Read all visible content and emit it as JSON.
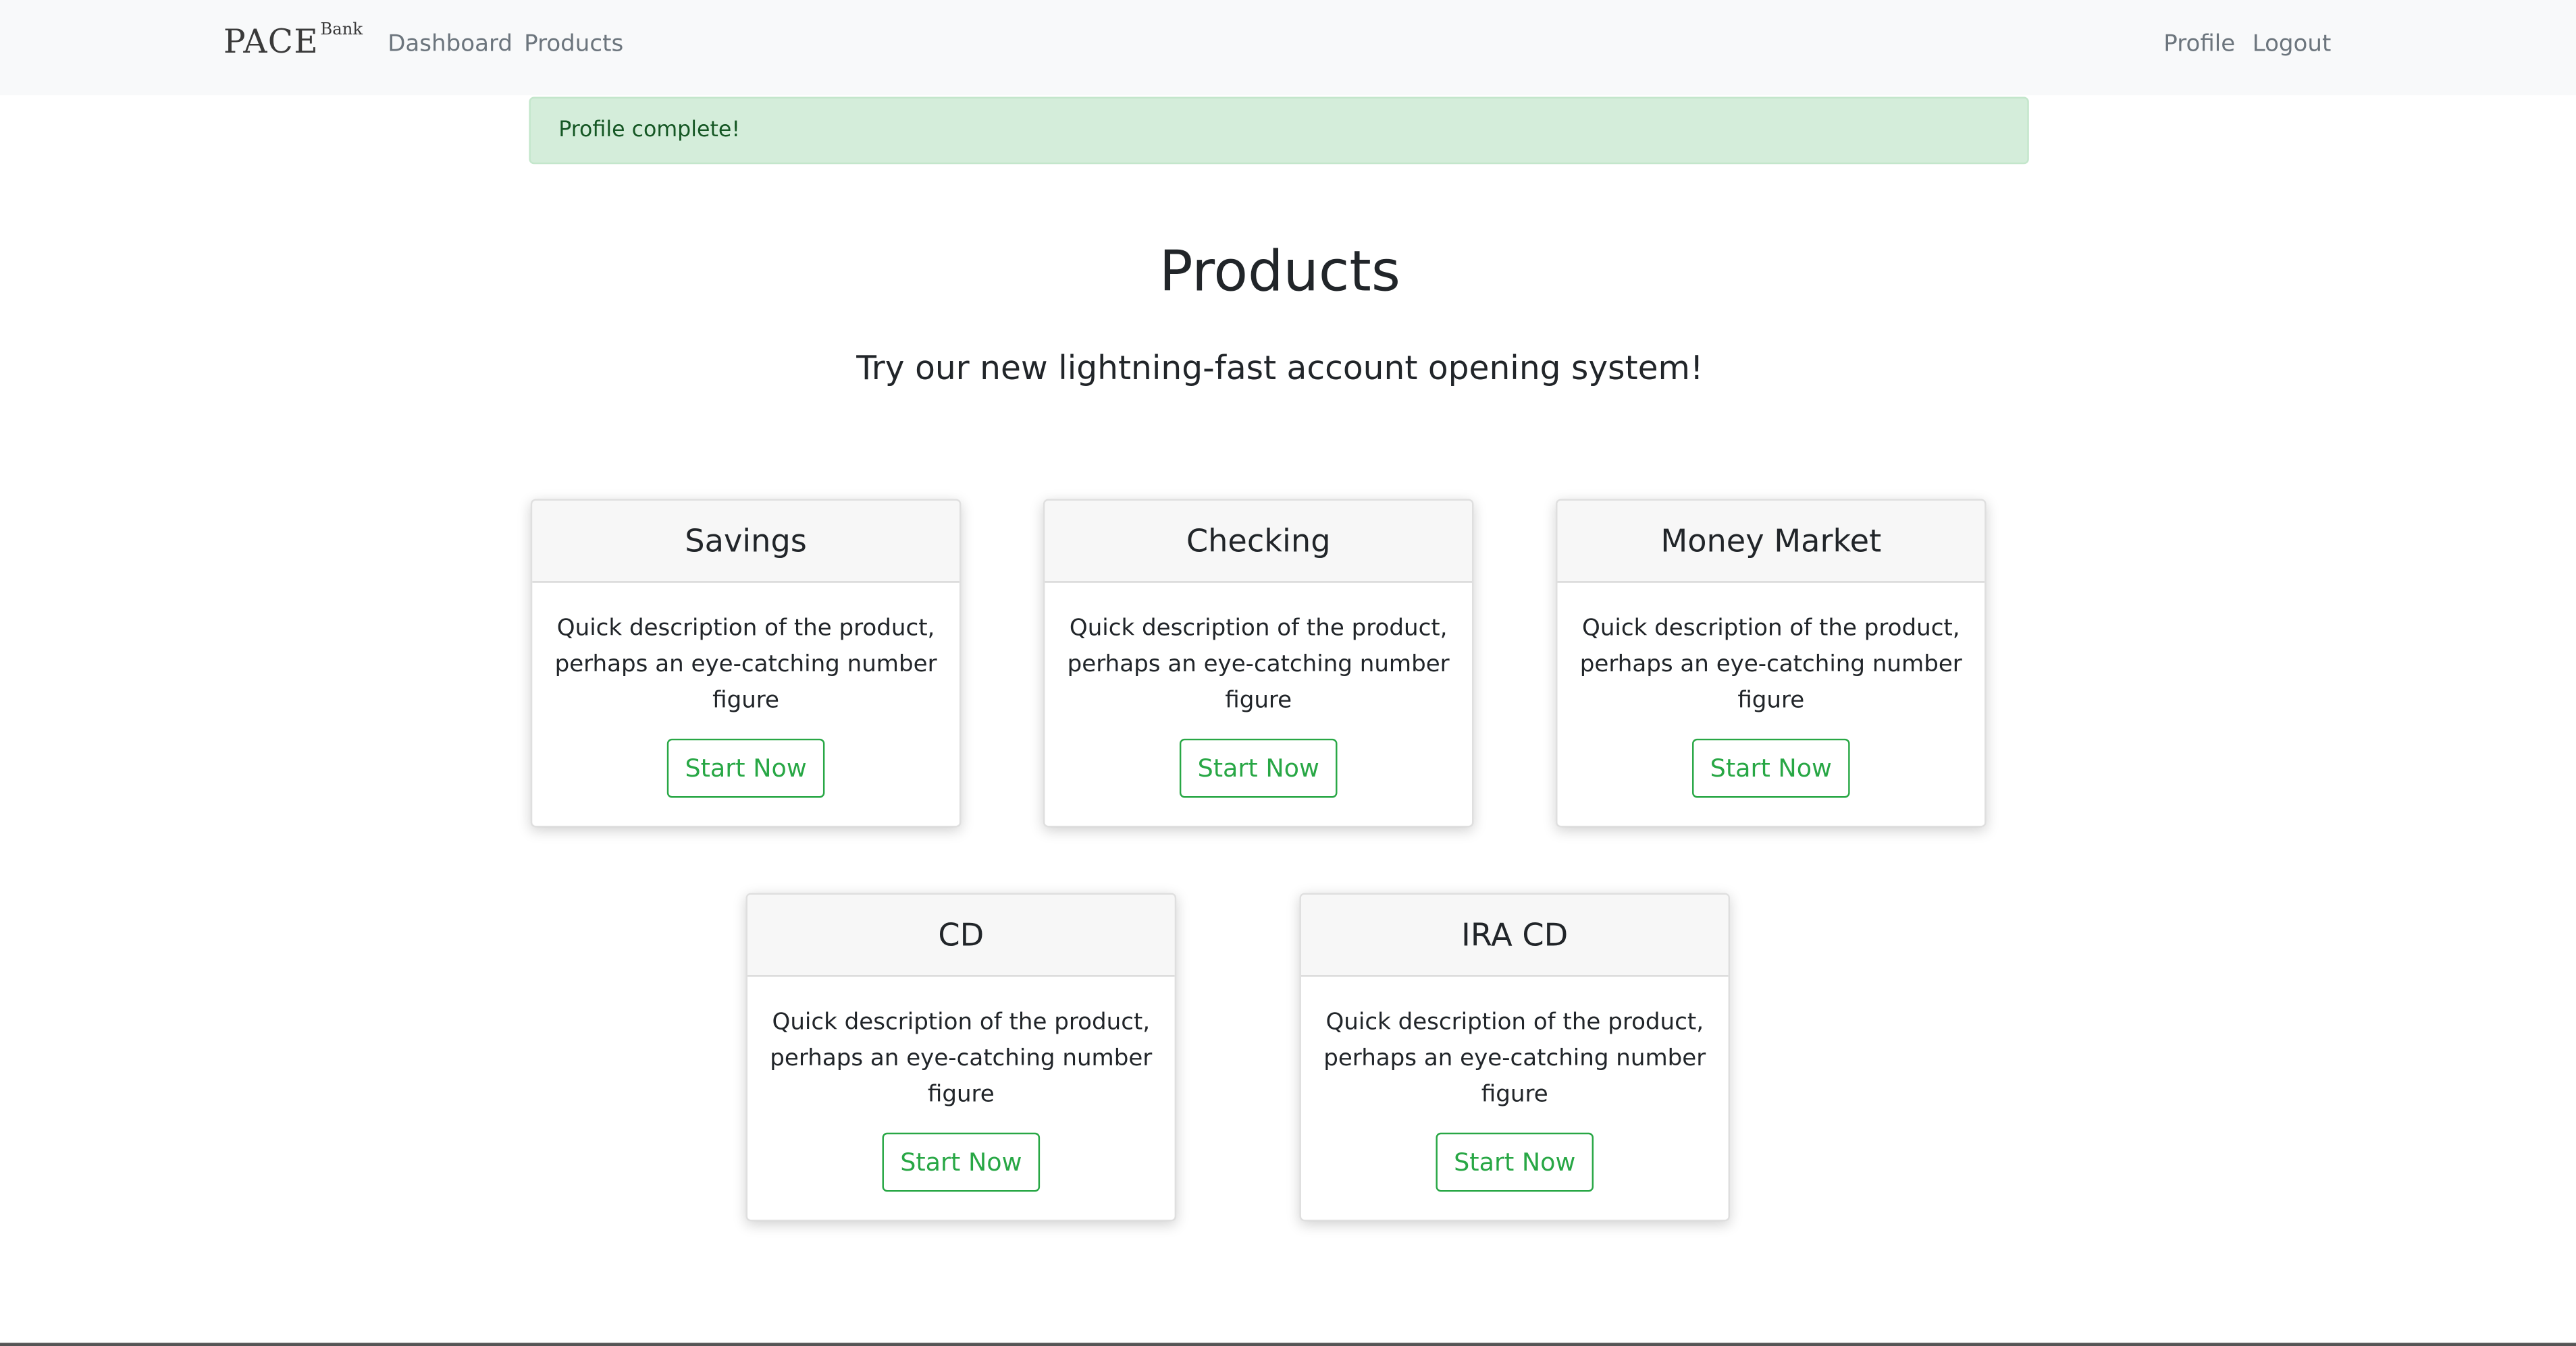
{
  "navbar": {
    "brand": "PACE",
    "brand_sup": "Bank",
    "links_left": [
      "Dashboard",
      "Products"
    ],
    "links_right": [
      "Profile",
      "Logout"
    ]
  },
  "alert": {
    "text": "Profile complete!",
    "color": "#d4edda"
  },
  "page": {
    "title": "Products",
    "subtitle": "Try our new lightning-fast account opening system!"
  },
  "products": [
    {
      "name": "Savings",
      "description": "Quick description of the product, perhaps an eye-catching number figure",
      "button": "Start Now"
    },
    {
      "name": "Checking",
      "description": "Quick description of the product, perhaps an eye-catching number figure",
      "button": "Start Now"
    },
    {
      "name": "Money Market",
      "description": "Quick description of the product, perhaps an eye-catching number figure",
      "button": "Start Now"
    },
    {
      "name": "CD",
      "description": "Quick description of the product, perhaps an eye-catching number figure",
      "button": "Start Now"
    },
    {
      "name": "IRA CD",
      "description": "Quick description of the product, perhaps an eye-catching number figure",
      "button": "Start Now"
    }
  ],
  "colors": {
    "accent": "#28a745",
    "navbar_bg": "#f8f9fa",
    "nav_link": "#6c757d"
  }
}
